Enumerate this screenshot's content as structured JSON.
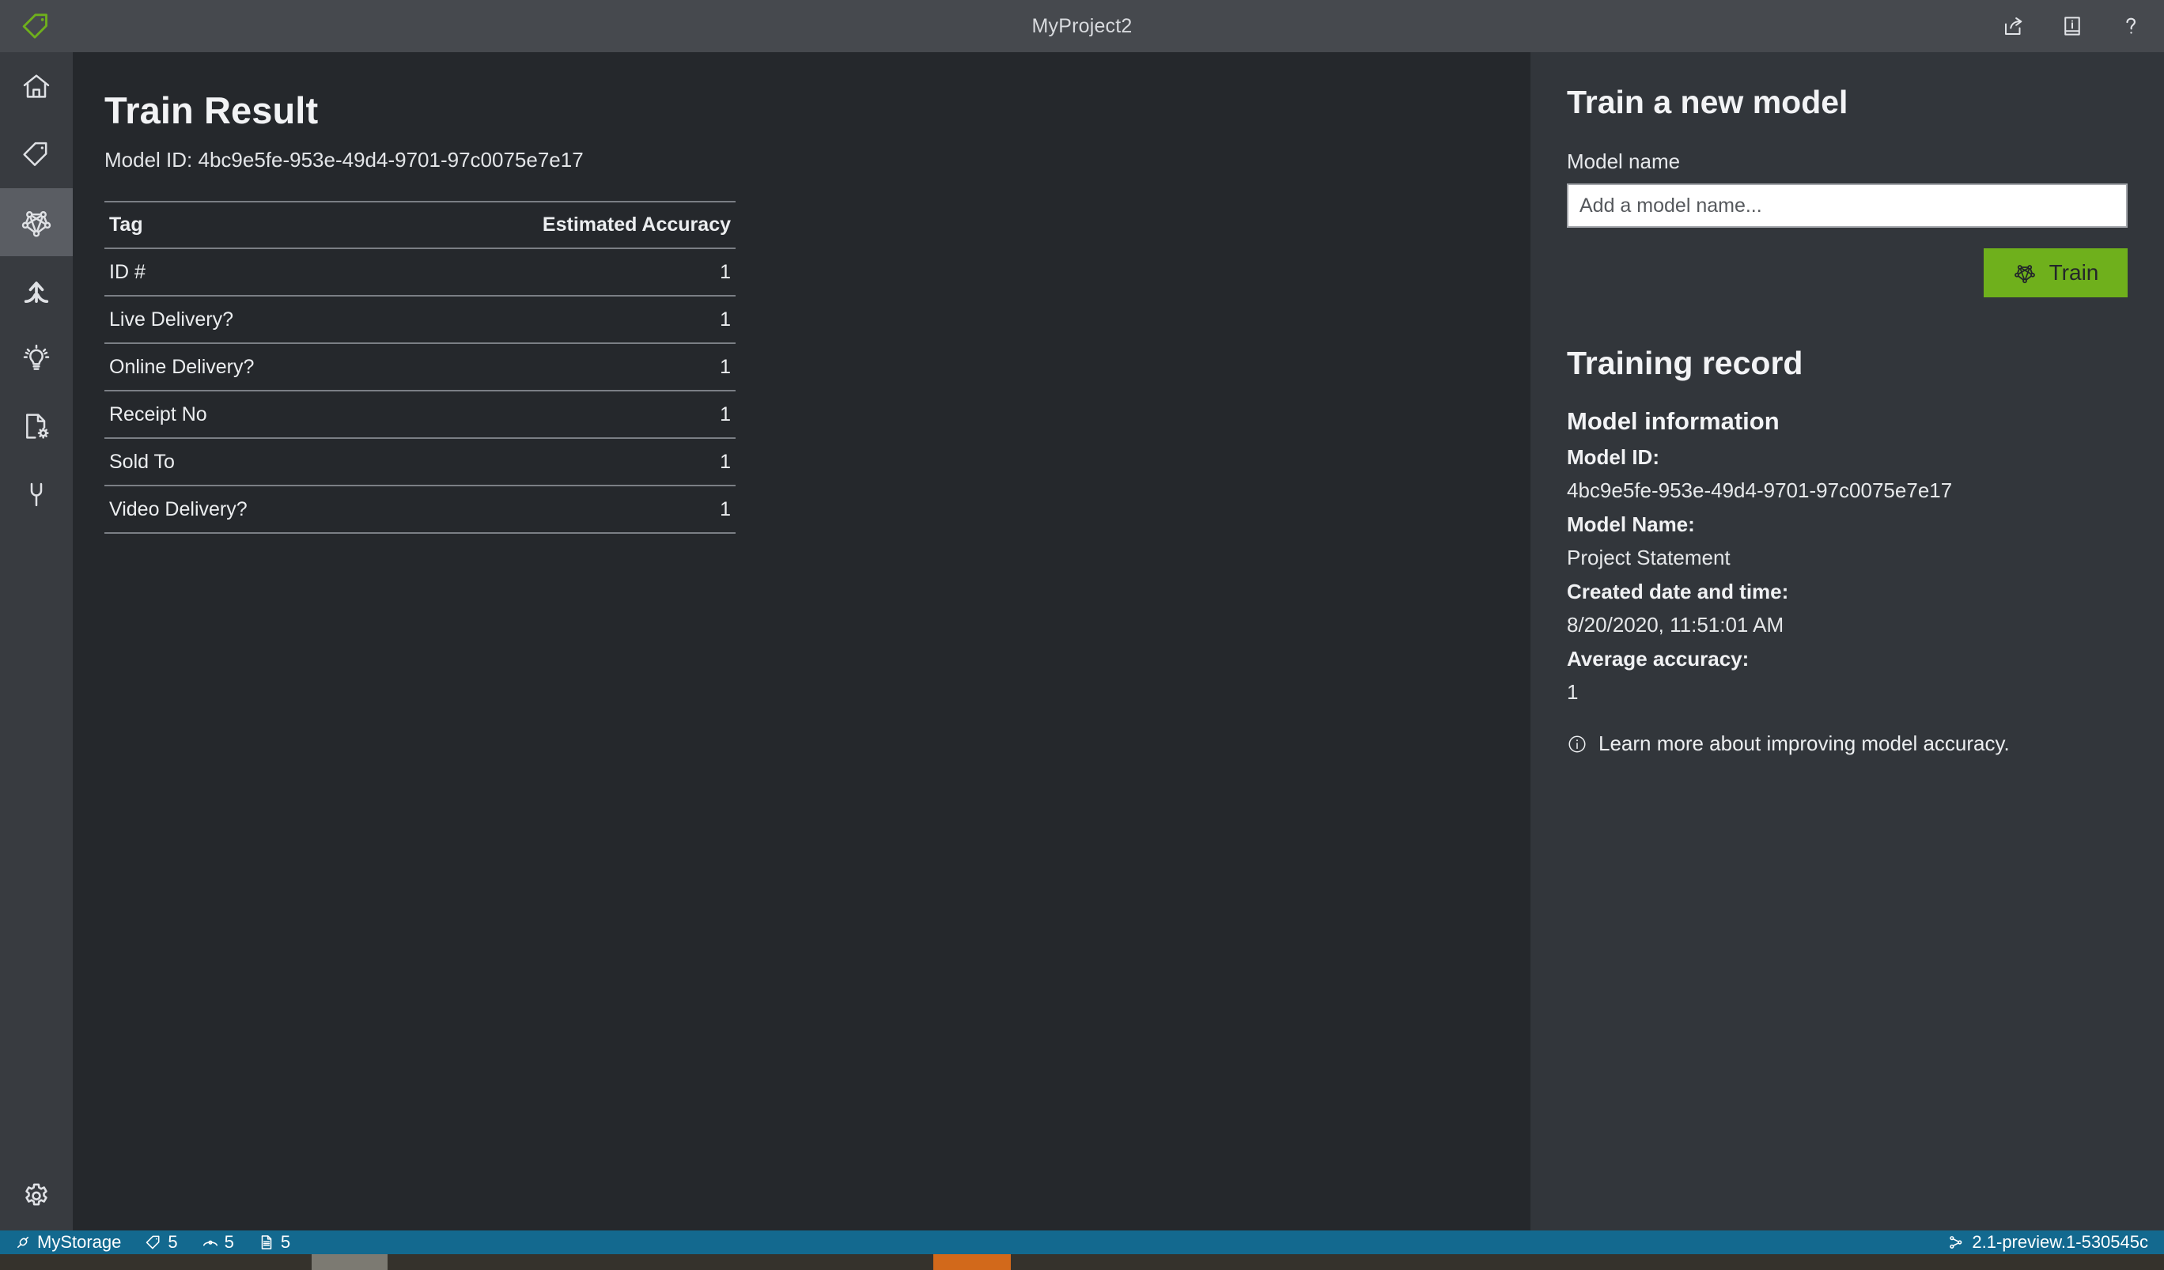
{
  "titlebar": {
    "logo_icon": "tag-logo-icon",
    "title": "MyProject2",
    "actions": [
      {
        "name": "share-icon",
        "label": "Share"
      },
      {
        "name": "documentation-icon",
        "label": "Documentation"
      },
      {
        "name": "help-icon",
        "label": "Help"
      }
    ]
  },
  "sidebar": {
    "items": [
      {
        "name": "home",
        "icon": "home-icon",
        "label": "Home",
        "selected": false
      },
      {
        "name": "tags",
        "icon": "tag-icon",
        "label": "Tag Editor",
        "selected": false
      },
      {
        "name": "model-compose",
        "icon": "network-model-icon",
        "label": "Train",
        "selected": true
      },
      {
        "name": "compose",
        "icon": "merge-arrow-icon",
        "label": "Model Compose",
        "selected": false
      },
      {
        "name": "analyze",
        "icon": "lightbulb-icon",
        "label": "Analyze",
        "selected": false
      },
      {
        "name": "prebuilt",
        "icon": "document-gear-icon",
        "label": "Prebuilt Analyze",
        "selected": false
      },
      {
        "name": "connections",
        "icon": "plug-icon",
        "label": "Connections",
        "selected": false
      }
    ],
    "bottom_item": {
      "name": "settings",
      "icon": "gear-icon",
      "label": "Settings"
    }
  },
  "main": {
    "page_title": "Train Result",
    "model_id_label": "Model ID:",
    "model_id_value": "4bc9e5fe-953e-49d4-9701-97c0075e7e17",
    "model_id_line": "Model ID: 4bc9e5fe-953e-49d4-9701-97c0075e7e17",
    "table": {
      "columns": [
        "Tag",
        "Estimated Accuracy"
      ],
      "rows": [
        {
          "tag": "ID #",
          "accuracy": "1"
        },
        {
          "tag": "Live Delivery?",
          "accuracy": "1"
        },
        {
          "tag": "Online Delivery?",
          "accuracy": "1"
        },
        {
          "tag": "Receipt No",
          "accuracy": "1"
        },
        {
          "tag": "Sold To",
          "accuracy": "1"
        },
        {
          "tag": "Video Delivery?",
          "accuracy": "1"
        }
      ]
    }
  },
  "panel": {
    "train_heading": "Train a new model",
    "model_name_label": "Model name",
    "model_name_value": "",
    "model_name_placeholder": "Add a model name...",
    "train_button_label": "Train",
    "train_button_icon": "network-model-icon",
    "train_button_color": "#6fb01c",
    "training_record_heading": "Training record",
    "model_information_heading": "Model information",
    "fields": [
      {
        "key": "Model ID:",
        "value": "4bc9e5fe-953e-49d4-9701-97c0075e7e17"
      },
      {
        "key": "Model Name:",
        "value": "Project Statement"
      },
      {
        "key": "Created date and time:",
        "value": "8/20/2020, 11:51:01 AM"
      },
      {
        "key": "Average accuracy:",
        "value": "1"
      }
    ],
    "learn_more": {
      "icon": "info-circle-icon",
      "text": "Learn more about improving model accuracy."
    }
  },
  "statusbar": {
    "background": "#13698f",
    "connection_icon": "plug-icon",
    "connection_name": "MyStorage",
    "counters": [
      {
        "icon": "tag-icon",
        "value": "5"
      },
      {
        "icon": "eye-icon",
        "value": "5"
      },
      {
        "icon": "document-icon",
        "value": "5"
      }
    ],
    "version_icon": "git-branch-icon",
    "version": "2.1-preview.1-530545c"
  }
}
